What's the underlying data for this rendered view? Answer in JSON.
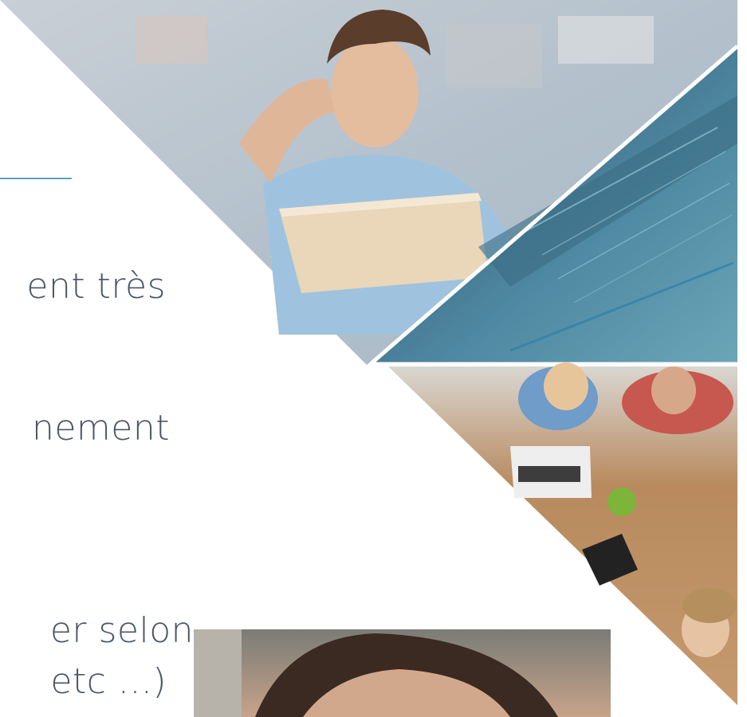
{
  "slide": {
    "text_fragments": {
      "line1": "ent très",
      "line2": "nement",
      "line3": "er selon",
      "line4": "etc ...)"
    },
    "colors": {
      "text": "#4a5566",
      "accent_rule": "#5aa0cf",
      "background": "#ffffff"
    }
  },
  "images": [
    {
      "name": "man-with-tablet-photo"
    },
    {
      "name": "code-editor-screen-photo"
    },
    {
      "name": "team-at-desk-photo"
    },
    {
      "name": "video-frame-photo"
    }
  ]
}
